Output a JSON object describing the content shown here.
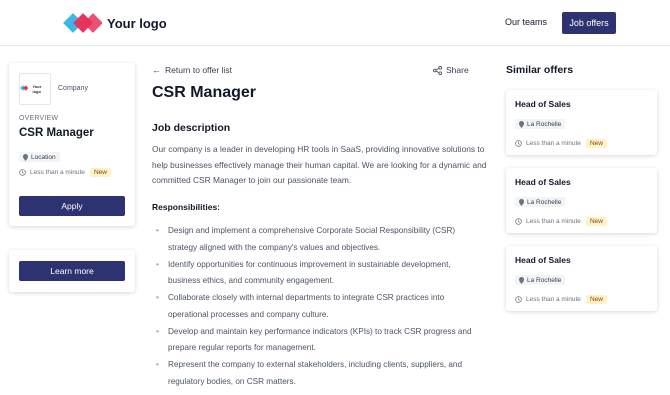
{
  "header": {
    "logo_text": "Your logo",
    "nav_link": "Our teams",
    "nav_button": "Job offers"
  },
  "sidebar": {
    "company_logo_text": "Your logo",
    "company_name": "Company",
    "overview_label": "OVERVIEW",
    "job_title": "CSR Manager",
    "location": "Location",
    "posted": "Less than a minute",
    "badge": "New",
    "apply_label": "Apply",
    "learn_more_label": "Learn more"
  },
  "main": {
    "back_label": "Return to offer list",
    "share_label": "Share",
    "title": "CSR Manager",
    "section_title": "Job description",
    "description": "Our company is a leader in developing HR tools in SaaS, providing innovative solutions to help businesses effectively manage their human capital. We are looking for a dynamic and committed CSR Manager to join our passionate team.",
    "responsibilities_title": "Responsibilities:",
    "responsibilities": [
      "Design and implement a comprehensive Corporate Social Responsibility (CSR) strategy aligned with the company's values and objectives.",
      "Identify opportunities for continuous improvement in sustainable development, business ethics, and community engagement.",
      "Collaborate closely with internal departments to integrate CSR practices into operational processes and company culture.",
      "Develop and maintain key performance indicators (KPIs) to track CSR progress and prepare regular reports for management.",
      "Represent the company to external stakeholders, including clients, suppliers, and regulatory bodies, on CSR matters."
    ]
  },
  "similar": {
    "title": "Similar offers",
    "offers": [
      {
        "title": "Head of Sales",
        "location": "La Rochelle",
        "posted": "Less than a minute",
        "badge": "New"
      },
      {
        "title": "Head of Sales",
        "location": "La Rochelle",
        "posted": "Less than a minute",
        "badge": "New"
      },
      {
        "title": "Head of Sales",
        "location": "La Rochelle",
        "posted": "Less than a minute",
        "badge": "New"
      }
    ]
  },
  "colors": {
    "primary": "#2d3270",
    "logo_cyan": "#3bb6e6",
    "logo_pink": "#e8335d",
    "badge_bg": "#fef3c7"
  },
  "icons": [
    "logo-diamonds",
    "arrow-left-icon",
    "share-icon",
    "location-pin-icon",
    "clock-icon"
  ]
}
